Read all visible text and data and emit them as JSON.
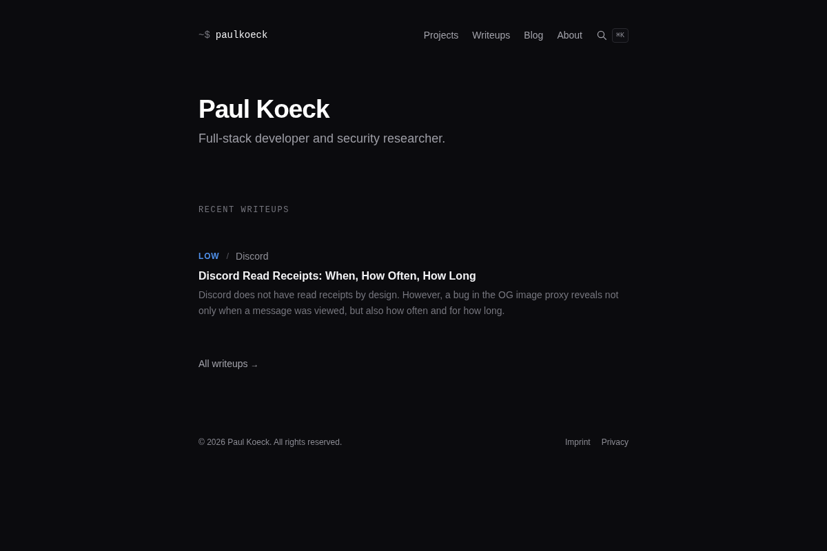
{
  "header": {
    "prompt": "~$",
    "site_name": "paulkoeck",
    "nav": [
      {
        "label": "Projects"
      },
      {
        "label": "Writeups"
      },
      {
        "label": "Blog"
      },
      {
        "label": "About"
      }
    ],
    "search_shortcut": "⌘K"
  },
  "hero": {
    "title": "Paul Koeck",
    "subtitle": "Full-stack developer and security researcher."
  },
  "recent_writeups": {
    "heading": "RECENT WRITEUPS",
    "items": [
      {
        "severity": "LOW",
        "color": "#4f8fe8",
        "separator": "/",
        "category": "Discord",
        "title": "Discord Read Receipts: When, How Often, How Long",
        "summary": "Discord does not have read receipts by design. However, a bug in the OG image proxy reveals not only when a message was viewed, but also how often and for how long."
      }
    ],
    "all_link": {
      "label": "All writeups",
      "arrow": "→"
    }
  },
  "footer": {
    "copyright": "© 2026 Paul Koeck. All rights reserved.",
    "links": [
      {
        "label": "Imprint"
      },
      {
        "label": "Privacy"
      }
    ]
  }
}
